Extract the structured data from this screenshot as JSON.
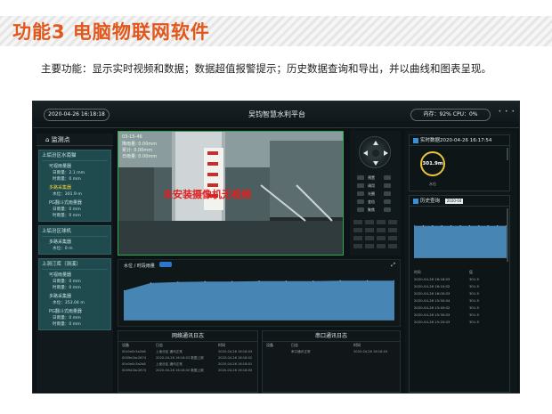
{
  "slide": {
    "title": "功能3  电脑物联网软件",
    "description": "主要功能：显示实时视频和数据；数据超值报警提示；历史数据查询和导出，并以曲线和图表呈现。"
  },
  "app": {
    "datetime": "2020-04-26 16:18:18",
    "title": "吴钧智慧水利平台",
    "system_status": "内存：92% CPU：0%",
    "dots": "• • •"
  },
  "monitor_panel": {
    "header": "监测点",
    "groups": [
      {
        "title": "上垢汾区水南猫",
        "sensors": [
          {
            "name": "可视雨量器",
            "rows": [
              "日雨量：2.1 mm",
              "时雨量：0 mm"
            ],
            "alert": false
          },
          {
            "name": "多路采集器",
            "rows": [
              "水位：301.9 m"
            ],
            "alert": true
          },
          {
            "name": "PG翻斗式雨量器",
            "rows": [
              "日雨量：0 mm",
              "时雨量：0 mm"
            ],
            "alert": false
          }
        ]
      },
      {
        "title": "上垢汾区球机",
        "sensors": [
          {
            "name": "多路采集器",
            "rows": [
              "水位：0 m"
            ],
            "alert": false
          }
        ]
      },
      {
        "title": "上涧汀库（涧溪）",
        "sensors": [
          {
            "name": "可视雨量器",
            "rows": [
              "日雨量：0 mm",
              "时雨量：0 mm"
            ],
            "alert": false
          },
          {
            "name": "多路采集器",
            "rows": [
              "水位：353.04 m"
            ],
            "alert": false
          },
          {
            "name": "PG翻斗式雨量器",
            "rows": [
              "日雨量：0 mm",
              "时雨量：0 mm"
            ],
            "alert": false
          }
        ]
      }
    ]
  },
  "video": {
    "overlay_time": "03-15-46",
    "overlay_lines": [
      "降雨量: 0.00mm",
      "累计: 0.00mm",
      "日雨量: 0.00mm"
    ],
    "no_video_text": "未安装摄像机无视频"
  },
  "ptz": {
    "labels": [
      "预置",
      "调用",
      "光圈",
      "变倍",
      "聚焦"
    ]
  },
  "chart_panel": {
    "label": "水位 / 时段雨量",
    "chart_data": {
      "type": "area",
      "x": [
        "0",
        "1",
        "2",
        "3",
        "4",
        "5",
        "6",
        "7",
        "8",
        "9",
        "10"
      ],
      "values": [
        0.62,
        0.78,
        0.8,
        0.81,
        0.81,
        0.82,
        0.82,
        0.82,
        0.83,
        0.83,
        0.83
      ],
      "title": "",
      "xlabel": "",
      "ylabel": "",
      "ylim": [
        0,
        1
      ]
    }
  },
  "logs": {
    "network": {
      "title": "网络通讯日志",
      "columns": [
        "设备",
        "日志",
        "时间"
      ],
      "rows": [
        [
          "00c0e0c3a2b8",
          "上垢汾区 通讯正常",
          "2020-04-26 16:18:03"
        ],
        [
          "0009e2bc2674",
          "2020-04-26 16:18:03 数据上报",
          "2020-04-26 16:18:02"
        ],
        [
          "00c0e0c3a2b8",
          "上垢汾区 通讯正常",
          "2020-04-26 16:18:01"
        ],
        [
          "0009e2bc2674",
          "2020-04-26 16:18:00 数据上报",
          "2020-04-26 16:18:00"
        ]
      ]
    },
    "serial": {
      "title": "串口通讯日志",
      "columns": [
        "设备",
        "日志",
        "时间"
      ],
      "rows": [
        [
          "",
          "串口通讯正常",
          "2020-04-26 16:18:03"
        ]
      ]
    }
  },
  "right_panel": {
    "realtime": {
      "title": "实时数据2020-04-26 16:17:54",
      "gauge_value": "301.9m",
      "gauge_label": "水位"
    },
    "history": {
      "title": "历史查询",
      "select_value": "2020-04",
      "columns": [
        "时间",
        "值"
      ],
      "chart_data": {
        "type": "area",
        "x": [
          "0",
          "1",
          "2",
          "3",
          "4",
          "5",
          "6",
          "7",
          "8",
          "9",
          "10"
        ],
        "values": [
          0.7,
          0.7,
          0.7,
          0.7,
          0.7,
          0.7,
          0.7,
          0.7,
          0.7,
          0.7,
          0.7
        ],
        "title": "",
        "xlabel": "",
        "ylabel": "",
        "ylim": [
          0,
          1
        ]
      },
      "rows": [
        [
          "2020-04-26 16:18:03",
          "301.9"
        ],
        [
          "2020-04-26 16:10:02",
          "301.9"
        ],
        [
          "2020-04-26 16:00:03",
          "301.9"
        ],
        [
          "2020-04-26 15:50:04",
          "301.9"
        ],
        [
          "2020-04-26 15:40:02",
          "301.9"
        ],
        [
          "2020-04-26 15:30:03",
          "301.9"
        ],
        [
          "2020-04-26 15:20:03",
          "301.9"
        ]
      ]
    }
  },
  "colors": {
    "accent": "#e2571b",
    "panel": "#1f4a4e",
    "chart_fill": "#4e91c6",
    "alert": "#f4d03f",
    "no_video": "#e02020",
    "gauge": "#e8c63a"
  }
}
